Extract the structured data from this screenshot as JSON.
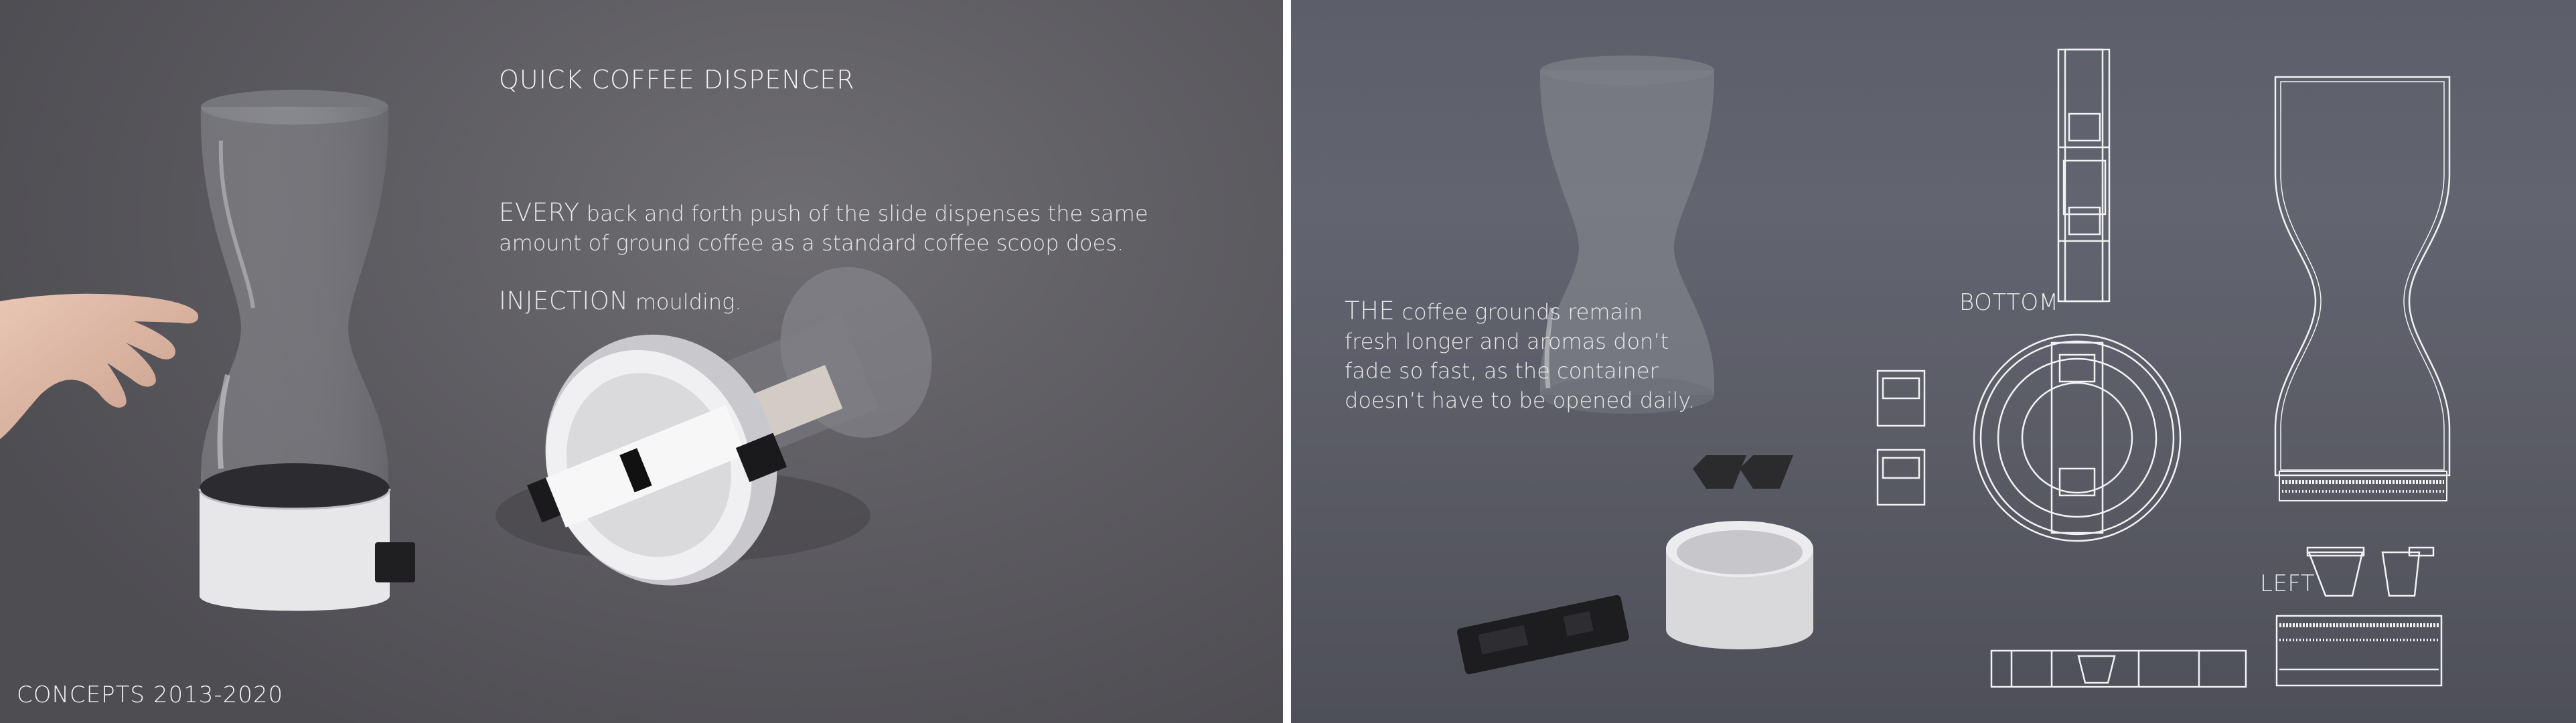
{
  "left_panel": {
    "title": "QUICK COFFEE DISPENCER",
    "paragraph1": {
      "lead": "EVERY",
      "line1_rest": " back and forth push of the slide dispenses the same",
      "line2": "amount of ground coffee as a standard coffee scoop does."
    },
    "paragraph2": {
      "lead": "INJECTION",
      "rest": " moulding."
    },
    "footer": "CONCEPTS 2013-2020"
  },
  "right_panel": {
    "paragraph": {
      "lead": "THE",
      "line1_rest": " coffee grounds remain",
      "line2": "fresh longer and aromas don’t",
      "line3": "fade so fast, as the container",
      "line4": "doesn’t have to be opened daily."
    },
    "label_bottom": "BOTTOM",
    "label_left": "LEFT"
  },
  "colors": {
    "left_background": "#5f5e63",
    "right_background": "#5e606b",
    "divider": "#ffffff",
    "text": "#f1f1f1"
  }
}
